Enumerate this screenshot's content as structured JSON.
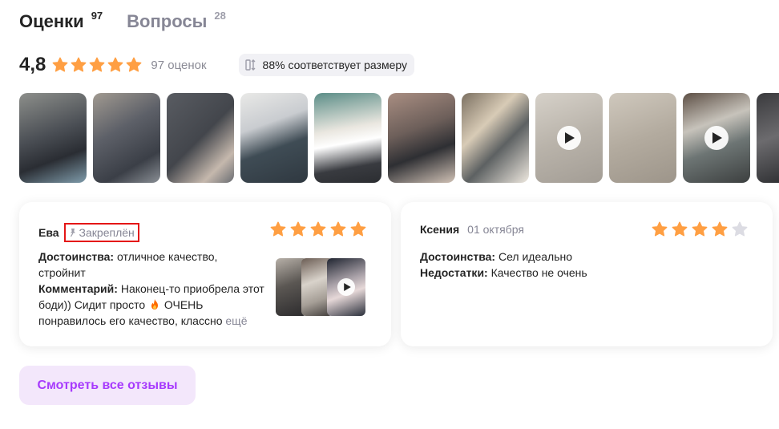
{
  "tabs": [
    {
      "label": "Оценки",
      "count": "97",
      "active": true
    },
    {
      "label": "Вопросы",
      "count": "28",
      "active": false
    }
  ],
  "rating": {
    "value": "4,8",
    "stars": 5,
    "count_text": "97 оценок",
    "size_badge": "88% соответствует размеру"
  },
  "photos": [
    {
      "icon": "photo"
    },
    {
      "icon": "photo"
    },
    {
      "icon": "photo"
    },
    {
      "icon": "photo"
    },
    {
      "icon": "photo"
    },
    {
      "icon": "photo"
    },
    {
      "icon": "photo"
    },
    {
      "icon": "play-icon"
    },
    {
      "icon": "photo"
    },
    {
      "icon": "play-icon"
    },
    {
      "icon": "photo"
    }
  ],
  "reviews": [
    {
      "author": "Ева",
      "pinned_label": "Закреплён",
      "rating": 5,
      "advantages_label": "Достоинства:",
      "advantages": "отличное качество, стройнит",
      "comment_label": "Комментарий:",
      "comment_1": "Наконец-то приобрела этот боди)) Сидит просто",
      "comment_2": "ОЧЕНЬ понравилось его качество, классно",
      "more": "ещё"
    },
    {
      "author": "Ксения",
      "date": "01 октября",
      "rating": 4,
      "advantages_label": "Достоинства:",
      "advantages": "Сел идеально",
      "disadvantages_label": "Недостатки:",
      "disadvantages": "Качество не очень"
    }
  ],
  "cta_label": "Смотреть все отзывы",
  "colors": {
    "star": "#ff9f43",
    "star_empty": "#dcdce3",
    "accent": "#a73afd",
    "cta_bg": "#f3e7fb",
    "highlight": "#e41616"
  }
}
